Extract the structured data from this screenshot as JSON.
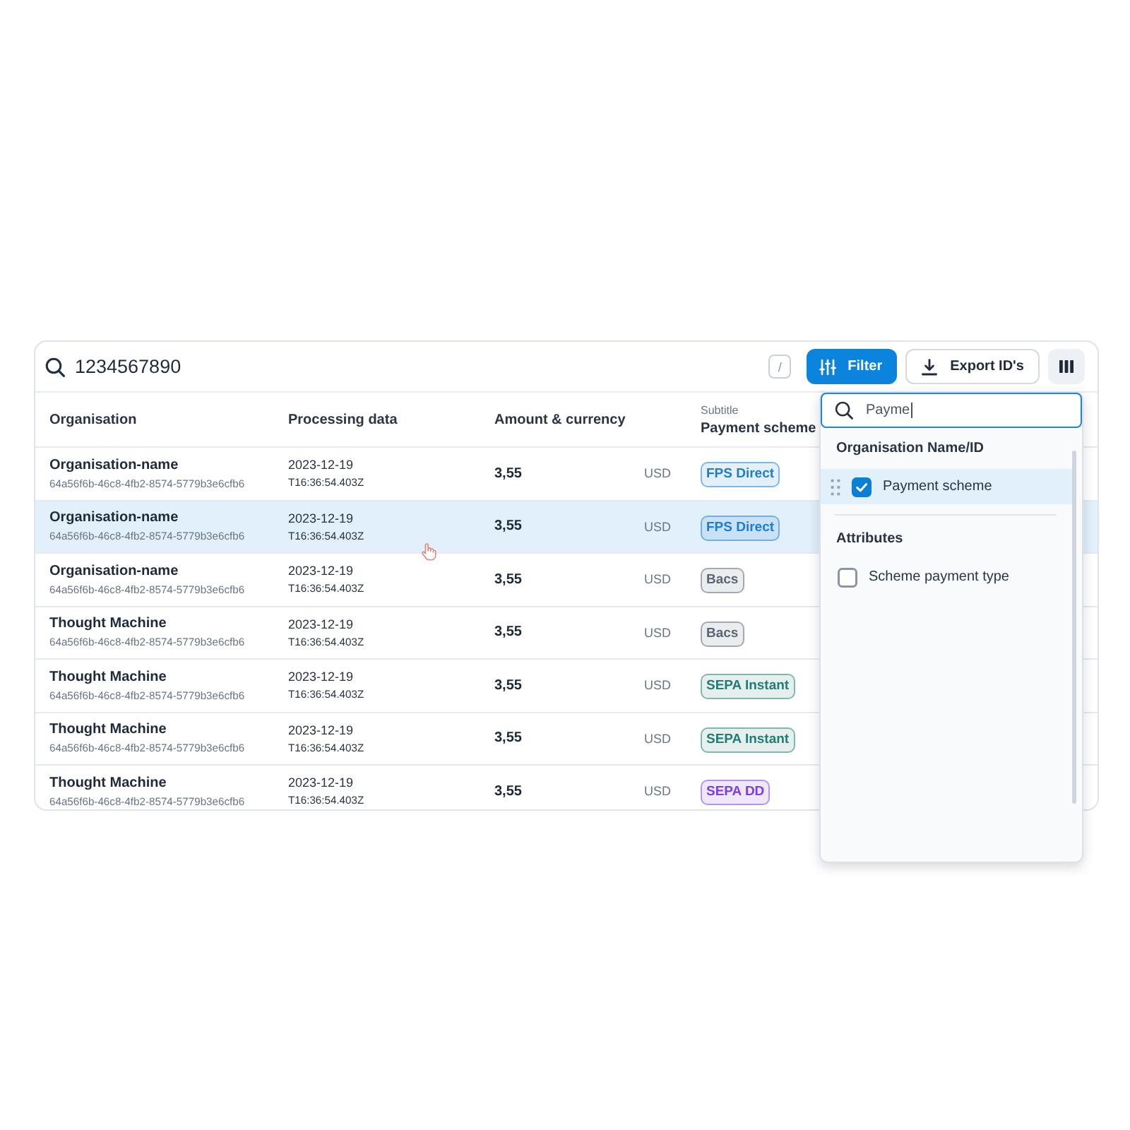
{
  "search": {
    "value": "1234567890",
    "shortcut_key": "/"
  },
  "filter_button": {
    "label": "Filter"
  },
  "export_button": {
    "label": "Export ID's"
  },
  "table": {
    "columns": [
      {
        "label": "Organisation"
      },
      {
        "label": "Processing data"
      },
      {
        "label": "Amount & currency"
      },
      {
        "subtitle": "Subtitle",
        "label": "Payment scheme"
      }
    ],
    "rows": [
      {
        "selected": false,
        "organisation": "Organisation-name",
        "organisation_id": "64a56f6b-46c8-4fb2-8574-5779b3e6cfb6",
        "date": "2023-12-19",
        "time": "T16:36:54.403Z",
        "amount": "3,55",
        "currency": "USD",
        "scheme": {
          "label": "FPS Direct",
          "color": "#1b7fd1"
        }
      },
      {
        "selected": true,
        "organisation": "Organisation-name",
        "organisation_id": "64a56f6b-46c8-4fb2-8574-5779b3e6cfb6",
        "date": "2023-12-19",
        "time": "T16:36:54.403Z",
        "amount": "3,55",
        "currency": "USD",
        "scheme": {
          "label": "FPS Direct",
          "color": "#1b7fd1"
        }
      },
      {
        "selected": false,
        "organisation": "Organisation-name",
        "organisation_id": "64a56f6b-46c8-4fb2-8574-5779b3e6cfb6",
        "date": "2023-12-19",
        "time": "T16:36:54.403Z",
        "amount": "3,55",
        "currency": "USD",
        "scheme": {
          "label": "Bacs",
          "color": "#5b6577"
        }
      },
      {
        "selected": false,
        "organisation": "Thought Machine",
        "organisation_id": "64a56f6b-46c8-4fb2-8574-5779b3e6cfb6",
        "date": "2023-12-19",
        "time": "T16:36:54.403Z",
        "amount": "3,55",
        "currency": "USD",
        "scheme": {
          "label": "Bacs",
          "color": "#5b6577"
        }
      },
      {
        "selected": false,
        "organisation": "Thought Machine",
        "organisation_id": "64a56f6b-46c8-4fb2-8574-5779b3e6cfb6",
        "date": "2023-12-19",
        "time": "T16:36:54.403Z",
        "amount": "3,55",
        "currency": "USD",
        "scheme": {
          "label": "SEPA Instant",
          "color": "#237d74"
        }
      },
      {
        "selected": false,
        "organisation": "Thought Machine",
        "organisation_id": "64a56f6b-46c8-4fb2-8574-5779b3e6cfb6",
        "date": "2023-12-19",
        "time": "T16:36:54.403Z",
        "amount": "3,55",
        "currency": "USD",
        "scheme": {
          "label": "SEPA Instant",
          "color": "#237d74"
        }
      },
      {
        "selected": false,
        "organisation": "Thought Machine",
        "organisation_id": "64a56f6b-46c8-4fb2-8574-5779b3e6cfb6",
        "date": "2023-12-19",
        "time": "T16:36:54.403Z",
        "amount": "3,55",
        "currency": "USD",
        "scheme": {
          "label": "SEPA DD",
          "color": "#7b3fe4"
        }
      }
    ]
  },
  "column_picker": {
    "search": {
      "value": "Payme"
    },
    "sections": [
      {
        "title": "Organisation Name/ID",
        "items": [
          {
            "label": "Payment scheme",
            "checked": true,
            "selected": true,
            "draggable": true
          }
        ]
      },
      {
        "title": "Attributes",
        "items": [
          {
            "label": "Scheme payment type",
            "checked": false,
            "selected": false,
            "draggable": false
          }
        ]
      }
    ]
  }
}
